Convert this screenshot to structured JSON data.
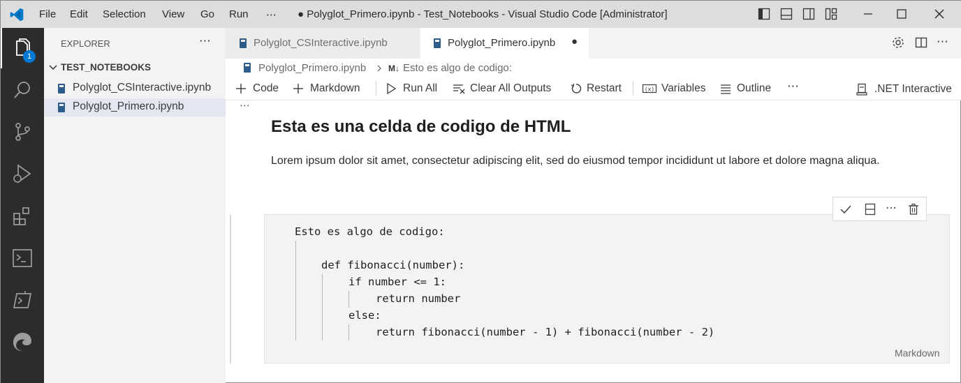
{
  "titlebar": {
    "menus": [
      "File",
      "Edit",
      "Selection",
      "View",
      "Go",
      "Run",
      "⋯"
    ],
    "title": "● Polyglot_Primero.ipynb - Test_Notebooks - Visual Studio Code [Administrator]"
  },
  "activity": {
    "explorer_badge": "1"
  },
  "sidebar": {
    "header": "EXPLORER",
    "more": "⋯",
    "folder": "TEST_NOTEBOOKS",
    "files": [
      "Polyglot_CSInteractive.ipynb",
      "Polyglot_Primero.ipynb"
    ]
  },
  "tabs": [
    {
      "label": "Polyglot_CSInteractive.ipynb",
      "active": false
    },
    {
      "label": "Polyglot_Primero.ipynb",
      "active": true,
      "modified": "●"
    }
  ],
  "breadcrumb": {
    "file": "Polyglot_Primero.ipynb",
    "separator": ">",
    "md_icon": "M↓",
    "section": "Esto es algo de codigo:"
  },
  "toolbar": {
    "code": "Code",
    "markdown": "Markdown",
    "run_all": "Run All",
    "clear_outputs": "Clear All Outputs",
    "restart": "Restart",
    "variables": "Variables",
    "outline": "Outline",
    "more": "⋯",
    "kernel": ".NET Interactive"
  },
  "cell1": {
    "more": "⋯",
    "heading": "Esta es una celda de codigo de HTML",
    "paragraph": "Lorem ipsum dolor sit amet, consectetur adipiscing elit, sed do eiusmod tempor incididunt ut labore et dolore magna aliqua."
  },
  "cell2": {
    "lines": [
      "Esto es algo de codigo:",
      "",
      "def fibonacci(number):",
      "if number <= 1:",
      "return number",
      "else:",
      "return fibonacci(number - 1) + fibonacci(number - 2)"
    ],
    "language": "Markdown",
    "cell_toolbar_more": "⋯"
  },
  "colors": {
    "titlebar": "#dddddd",
    "activitybar": "#2c2c2c",
    "sidebar": "#f3f3f3",
    "accent": "#0078d4",
    "vscode_blue": "#007acc",
    "selection": "#e4e6f1",
    "code_bg": "#f3f3f3"
  }
}
